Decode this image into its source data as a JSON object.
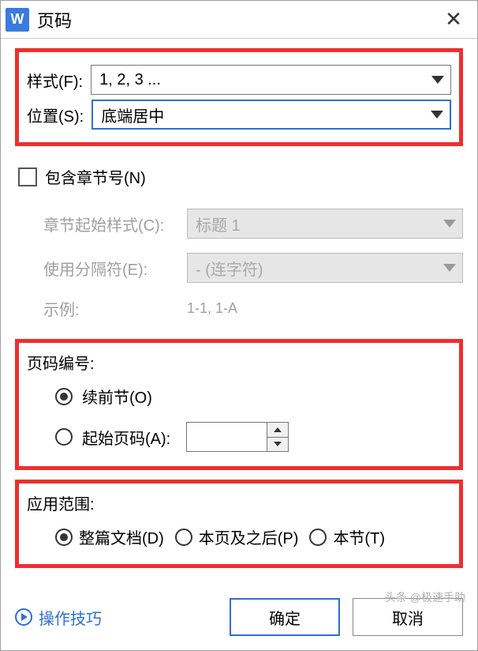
{
  "title": "页码",
  "app_icon_letter": "W",
  "style_block": {
    "format_label": "样式(F):",
    "format_value": "1, 2, 3 ...",
    "position_label": "位置(S):",
    "position_value": "底端居中"
  },
  "chapter": {
    "include_label": "包含章节号(N)",
    "start_style_label": "章节起始样式(C):",
    "start_style_value": "标题 1",
    "separator_label": "使用分隔符(E):",
    "separator_value": "-    (连字符)",
    "example_label": "示例:",
    "example_value": "1-1, 1-A"
  },
  "numbering": {
    "section_label": "页码编号:",
    "continue_label": "续前节(O)",
    "start_at_label": "起始页码(A):",
    "start_at_value": ""
  },
  "scope": {
    "section_label": "应用范围:",
    "whole_doc": "整篇文档(D)",
    "this_and_after": "本页及之后(P)",
    "this_section": "本节(T)"
  },
  "footer": {
    "tips": "操作技巧",
    "ok": "确定",
    "cancel": "取消"
  },
  "attribution": "头条 @极速手助"
}
